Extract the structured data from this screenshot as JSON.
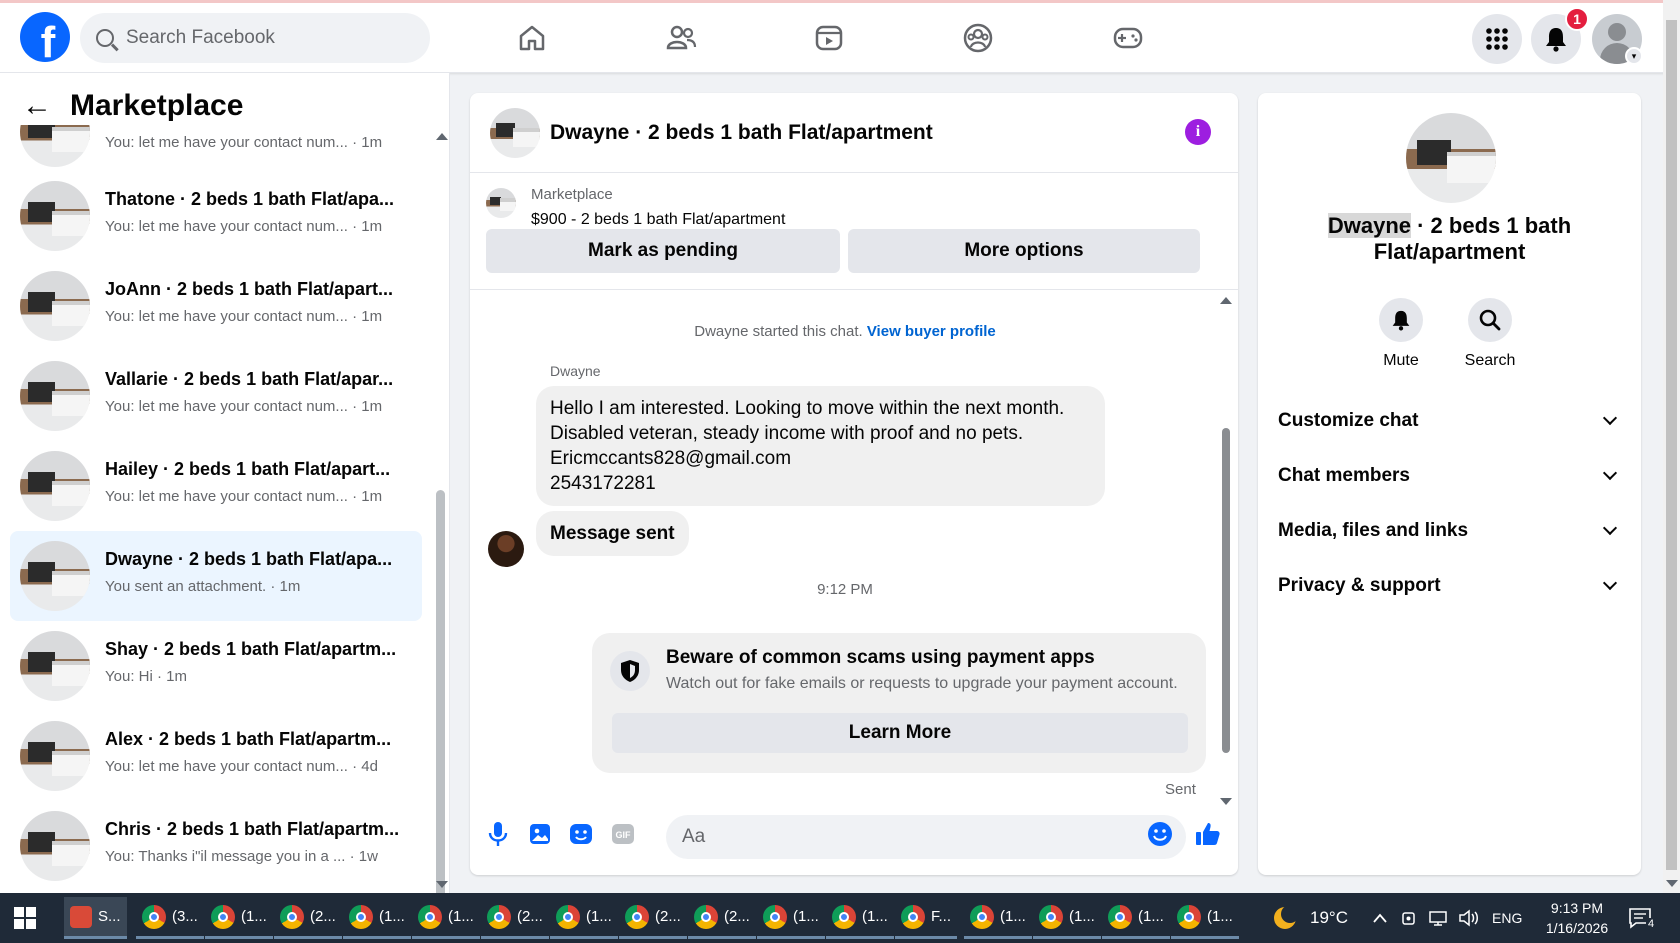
{
  "topbar": {
    "logo": "f",
    "search_placeholder": "Search Facebook",
    "notification_count": "1",
    "nav_icons": [
      "home-icon",
      "friends-icon",
      "watch-icon",
      "groups-icon",
      "gaming-icon"
    ]
  },
  "left": {
    "title": "Marketplace",
    "conversations": [
      {
        "title": "",
        "sub": "You: let me have your contact num... · 1m"
      },
      {
        "title": "Thatone · 2 beds 1 bath Flat/apa...",
        "sub": "You: let me have your contact num... · 1m"
      },
      {
        "title": "JoAnn · 2 beds 1 bath Flat/apart...",
        "sub": "You: let me have your contact num... · 1m"
      },
      {
        "title": "Vallarie · 2 beds 1 bath Flat/apar...",
        "sub": "You: let me have your contact num... · 1m"
      },
      {
        "title": "Hailey · 2 beds 1 bath Flat/apart...",
        "sub": "You: let me have your contact num... · 1m"
      },
      {
        "title": "Dwayne · 2 beds 1 bath Flat/apa...",
        "sub": "You sent an attachment. · 1m"
      },
      {
        "title": "Shay · 2 beds 1 bath Flat/apartm...",
        "sub": "You: Hi · 1m"
      },
      {
        "title": "Alex · 2 beds 1 bath Flat/apartm...",
        "sub": "You: let me have your contact num... · 4d"
      },
      {
        "title": "Chris · 2 beds 1 bath Flat/apartm...",
        "sub": "You: Thanks i\"il message you in a ... · 1w"
      }
    ]
  },
  "chat": {
    "header_title": "Dwayne · 2 beds 1 bath Flat/apartment",
    "marketplace_label": "Marketplace",
    "listing": "$900 - 2 beds 1 bath Flat/apartment",
    "mark_pending": "Mark as pending",
    "more_options": "More options",
    "started_text": "Dwayne started this chat.",
    "view_buyer": "View buyer profile",
    "sender_name": "Dwayne",
    "message_lines": [
      "Hello I am interested. Looking to move within the next month.",
      "Disabled veteran, steady income with proof and no pets.",
      "Ericmccants828@gmail.com",
      "2543172281"
    ],
    "message_sent": "Message sent",
    "timestamp": "9:12 PM",
    "scam_title": "Beware of common scams using payment apps",
    "scam_desc": "Watch out for fake emails or requests to upgrade your payment account.",
    "learn_more": "Learn More",
    "sent_status": "Sent",
    "composer_placeholder": "Aa"
  },
  "right": {
    "name": "Dwayne",
    "title_rest": " · 2 beds 1 bath",
    "title_line2": "Flat/apartment",
    "mute": "Mute",
    "search": "Search",
    "sections": [
      "Customize chat",
      "Chat members",
      "Media, files and links",
      "Privacy & support"
    ]
  },
  "taskbar": {
    "first_task": "S...",
    "tasks": [
      "(3...",
      "(1...",
      "(2...",
      "(1...",
      "(1...",
      "(2...",
      "(1...",
      "(2...",
      "(2...",
      "(1...",
      "(1...",
      "F...",
      "(1...",
      "(1...",
      "(1...",
      "(1..."
    ],
    "weather": "19°C",
    "language": "ENG",
    "time": "9:13 PM",
    "date": "1/16/2026",
    "notif_count": "4"
  },
  "colors": {
    "brand": "#0866ff",
    "active_row": "#ebf5ff",
    "link": "#0064d1",
    "info": "#9d1ee0",
    "badge": "#e41e3f"
  }
}
